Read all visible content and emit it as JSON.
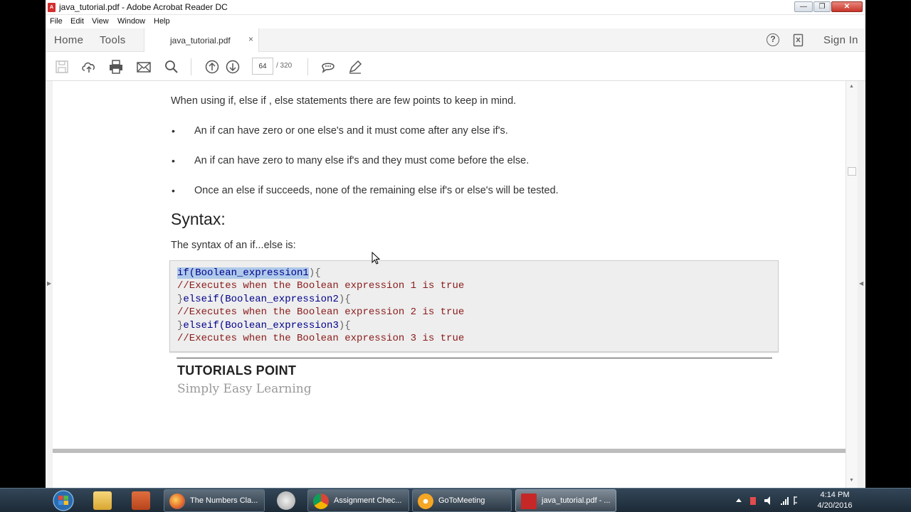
{
  "window": {
    "title": "java_tutorial.pdf - Adobe Acrobat Reader DC",
    "min_label": "—",
    "max_label": "❐",
    "close_label": "✕"
  },
  "menu": [
    "File",
    "Edit",
    "View",
    "Window",
    "Help"
  ],
  "tabs": {
    "home": "Home",
    "tools": "Tools",
    "document": "java_tutorial.pdf",
    "close": "×"
  },
  "header_right": {
    "help": "?",
    "signin": "Sign In"
  },
  "toolbar": {
    "icons": [
      "save-icon",
      "upload-icon",
      "print-icon",
      "email-icon",
      "search-icon",
      "page-up-icon",
      "page-down-icon",
      "comment-icon",
      "pen-icon"
    ],
    "page_current": "64",
    "page_total": "/  320"
  },
  "doc": {
    "intro": "When using if, else if , else statements there are few points to keep in mind.",
    "bullets": [
      "An if can have zero or one else's and it must come after any else if's.",
      "An if can have zero to many else if's and they must come before the else.",
      "Once an else if succeeds, none of the remaining else if's or else's will be tested."
    ],
    "bullet_mark": "•",
    "syntax_heading": "Syntax:",
    "syntax_intro": "The syntax of an if...else is:",
    "code": {
      "l1_kw": "if(Boolean_expression1",
      "l1_pun": "){",
      "l2": "//Executes when the Boolean expression 1 is true",
      "l3_pun": "}",
      "l3_kw": "elseif(Boolean_expression2",
      "l3_end": "){",
      "l4": "//Executes when the Boolean expression 2 is true",
      "l5_pun": "}",
      "l5_kw": "elseif(Boolean_expression3",
      "l5_end": "){",
      "l6": "//Executes when the Boolean expression 3 is true"
    },
    "brand": "TUTORIALS POINT",
    "tagline": "Simply Easy Learning"
  },
  "taskbar": {
    "buttons": [
      {
        "label": "The Numbers Cla...",
        "icon": "firefox-icon"
      },
      {
        "label": "Assignment Chec...",
        "icon": "chrome-icon"
      },
      {
        "label": "GoToMeeting",
        "icon": "gotomeeting-icon"
      },
      {
        "label": "java_tutorial.pdf - ...",
        "icon": "acrobat-icon"
      }
    ],
    "time": "4:14 PM",
    "date": "4/20/2016"
  }
}
